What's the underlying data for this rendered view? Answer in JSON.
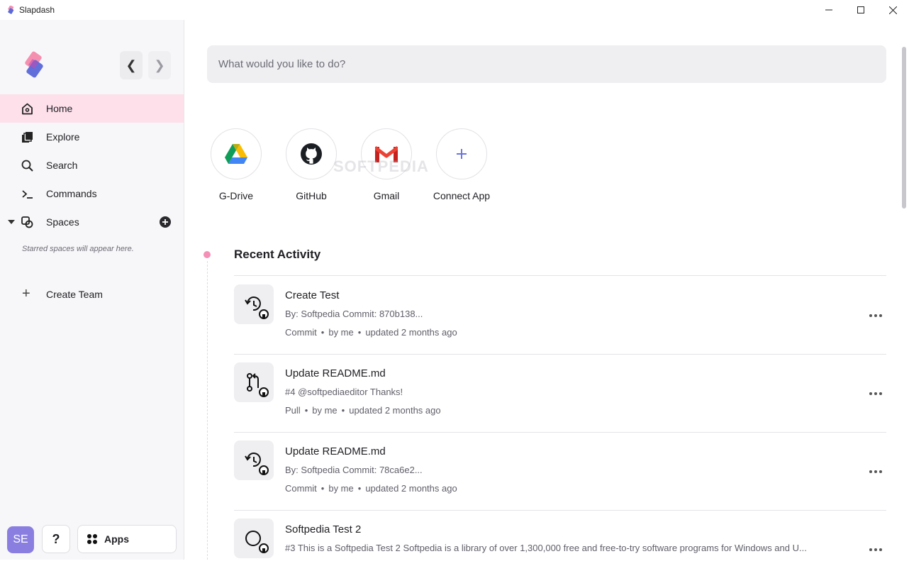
{
  "window": {
    "title": "Slapdash"
  },
  "sidebar": {
    "items": [
      {
        "label": "Home",
        "icon": "home-icon"
      },
      {
        "label": "Explore",
        "icon": "explore-icon"
      },
      {
        "label": "Search",
        "icon": "search-icon"
      },
      {
        "label": "Commands",
        "icon": "terminal-icon"
      },
      {
        "label": "Spaces",
        "icon": "spaces-icon"
      }
    ],
    "starred_note": "Starred spaces will appear here.",
    "create_team": "Create Team",
    "avatar_initials": "SE",
    "help_label": "?",
    "apps_label": "Apps"
  },
  "search": {
    "placeholder": "What would you like to do?"
  },
  "apps": [
    {
      "label": "G-Drive",
      "icon": "google-drive-icon"
    },
    {
      "label": "GitHub",
      "icon": "github-icon"
    },
    {
      "label": "Gmail",
      "icon": "gmail-icon"
    },
    {
      "label": "Connect App",
      "icon": "plus-icon"
    }
  ],
  "watermark": "SOFTPEDIA",
  "recent": {
    "title": "Recent Activity",
    "items": [
      {
        "title": "Create Test",
        "desc": "By: Softpedia Commit: 870b138...",
        "type": "Commit",
        "by": "by me",
        "updated": "updated 2 months ago",
        "icon": "commit-icon"
      },
      {
        "title": "Update README.md",
        "desc": "#4 @softpediaeditor Thanks!",
        "type": "Pull",
        "by": "by me",
        "updated": "updated 2 months ago",
        "icon": "pull-request-icon"
      },
      {
        "title": "Update README.md",
        "desc": "By: Softpedia Commit: 78ca6e2...",
        "type": "Commit",
        "by": "by me",
        "updated": "updated 2 months ago",
        "icon": "commit-icon"
      },
      {
        "title": "Softpedia Test 2",
        "desc": "#3 This is a Softpedia Test 2 Softpedia is a library of over 1,300,000 free and free-to-try software programs for Windows and U...",
        "type": "",
        "by": "",
        "updated": "",
        "icon": "issue-icon"
      }
    ]
  },
  "colors": {
    "accent": "#f48fb8",
    "active_bg": "#fde0ea",
    "avatar": "#8a7fe0"
  }
}
